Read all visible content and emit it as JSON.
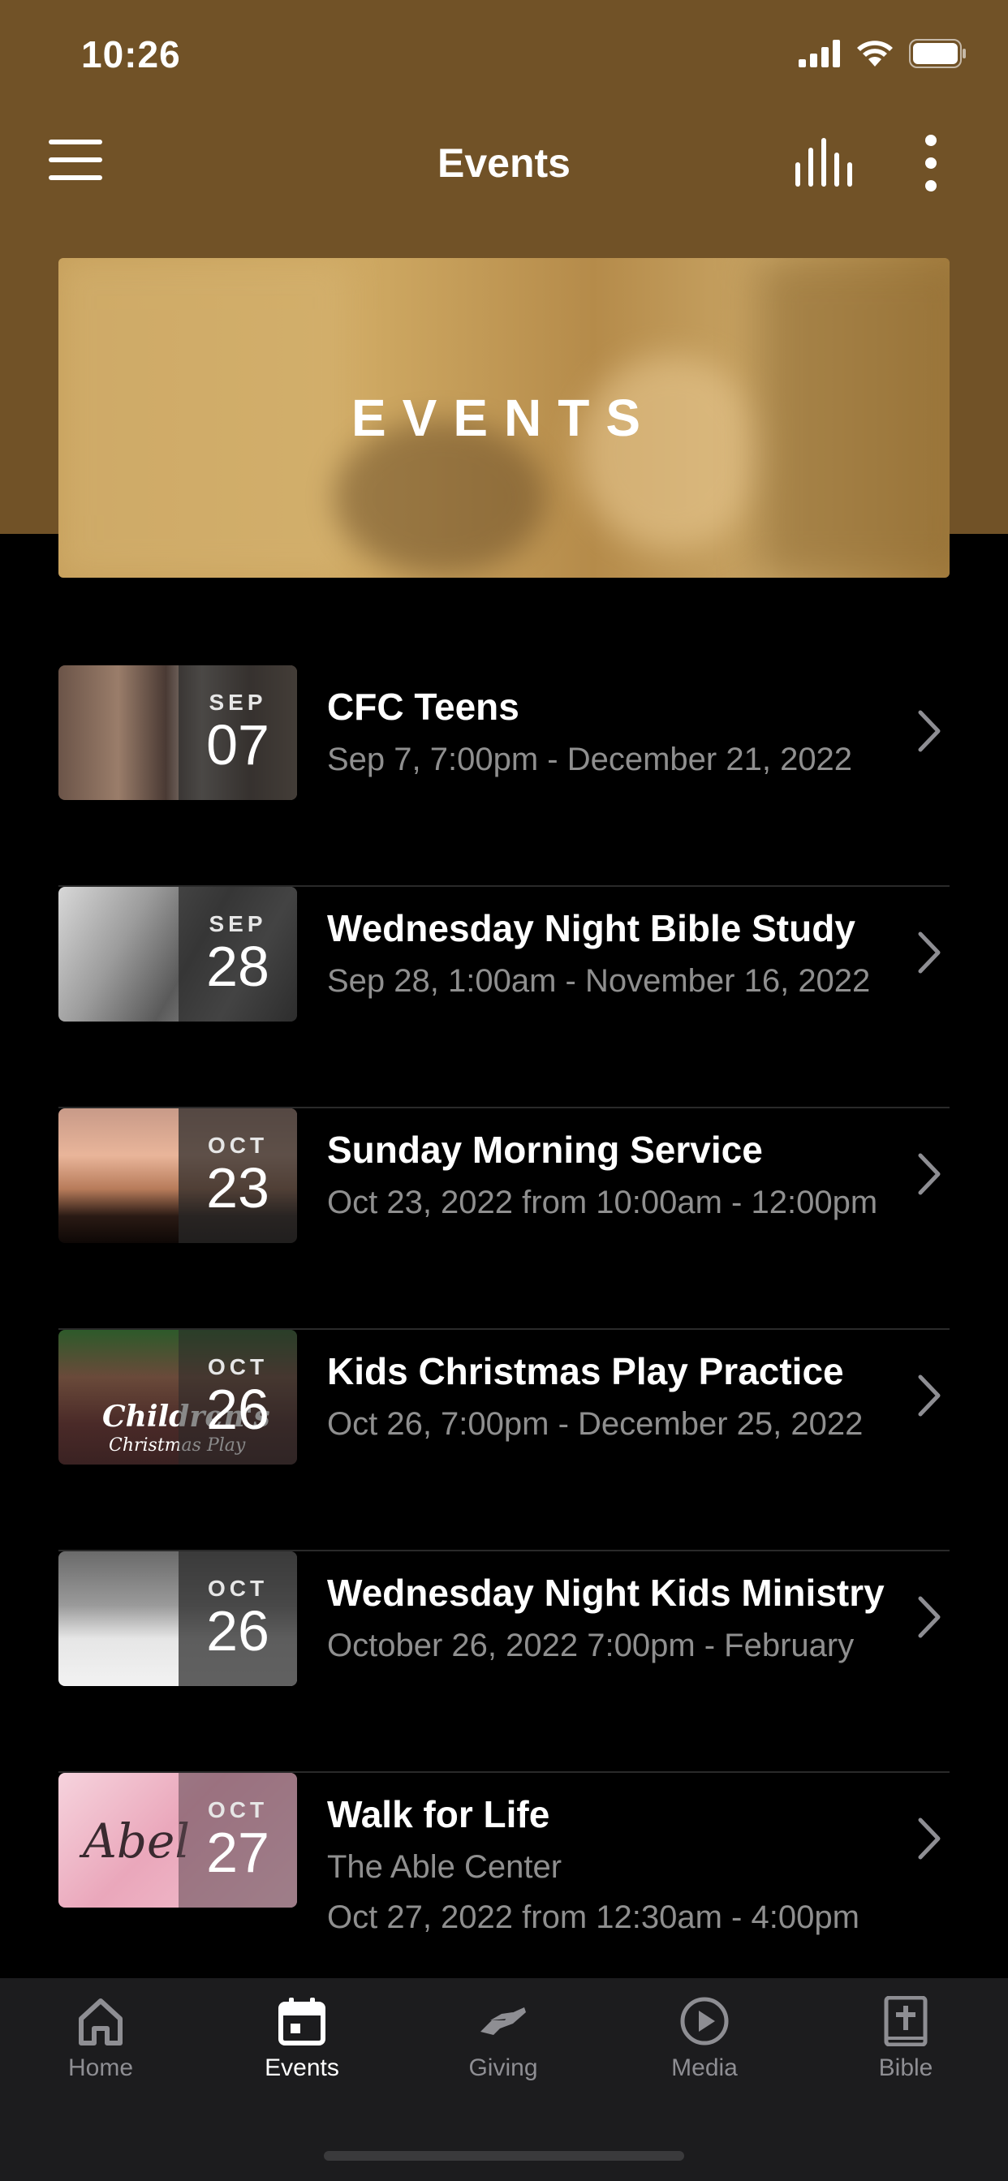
{
  "status": {
    "time": "10:26"
  },
  "nav": {
    "title": "Events"
  },
  "banner": {
    "text": "EVENTS"
  },
  "events": [
    {
      "title": "CFC Teens",
      "subtitle": "Sep 7, 7:00pm - December 21, 2022",
      "month": "SEP",
      "day": "07"
    },
    {
      "title": "Wednesday Night Bible Study",
      "subtitle": "Sep 28, 1:00am - November 16, 2022",
      "month": "SEP",
      "day": "28"
    },
    {
      "title": "Sunday Morning Service",
      "subtitle": "Oct 23, 2022 from 10:00am - 12:00pm",
      "month": "OCT",
      "day": "23"
    },
    {
      "title": "Kids Christmas Play Practice",
      "subtitle": "Oct 26, 7:00pm - December 25, 2022",
      "month": "OCT",
      "day": "26",
      "thumb_text": [
        "Children's",
        "Christmas Play"
      ]
    },
    {
      "title": "Wednesday Night Kids Ministry",
      "subtitle": "October 26, 2022 7:00pm - February",
      "month": "OCT",
      "day": "26"
    },
    {
      "title": "Walk for Life",
      "subtitle": "The Able Center",
      "subtitle2": "Oct 27, 2022 from 12:30am - 4:00pm",
      "month": "OCT",
      "day": "27",
      "thumb_text": [
        "Abel"
      ]
    }
  ],
  "tabs": [
    {
      "label": "Home",
      "icon": "home-icon",
      "active": false
    },
    {
      "label": "Events",
      "icon": "calendar-icon",
      "active": true
    },
    {
      "label": "Giving",
      "icon": "giving-hand-icon",
      "active": false
    },
    {
      "label": "Media",
      "icon": "play-circle-icon",
      "active": false
    },
    {
      "label": "Bible",
      "icon": "bible-icon",
      "active": false
    }
  ],
  "colors": {
    "header": "#715227",
    "background": "#000000",
    "tab_bar": "#1c1c1e",
    "muted_text": "#8f8f8f"
  }
}
